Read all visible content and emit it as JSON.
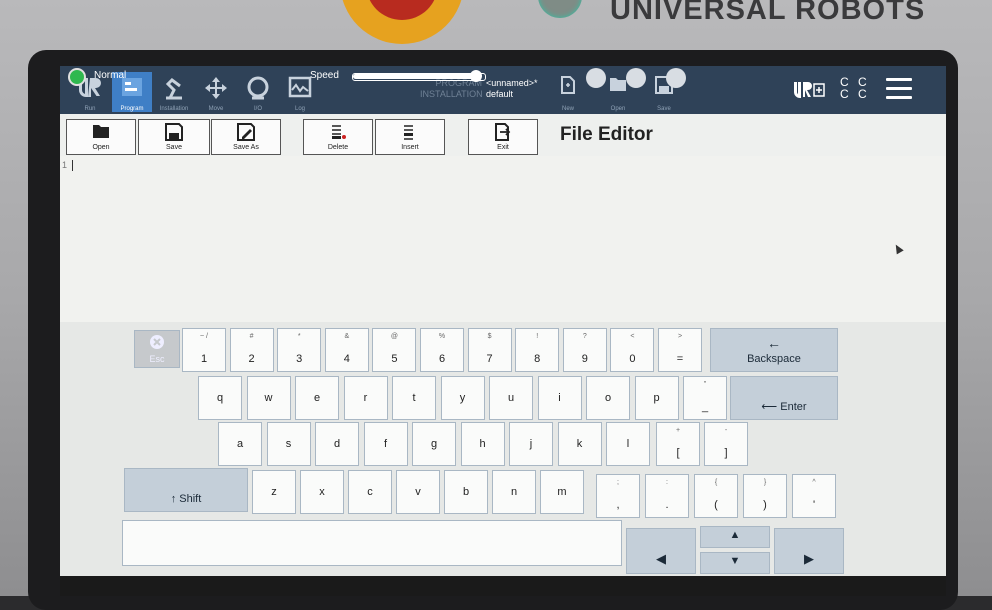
{
  "hardware": {
    "brand": "UNIVERSAL ROBOTS"
  },
  "nav": {
    "items": [
      {
        "label": "Run",
        "icon": "ur-logo-icon"
      },
      {
        "label": "Program",
        "icon": "program-icon",
        "active": true
      },
      {
        "label": "Installation",
        "icon": "installation-icon"
      },
      {
        "label": "Move",
        "icon": "move-icon"
      },
      {
        "label": "I/O",
        "icon": "io-icon"
      },
      {
        "label": "Log",
        "icon": "log-icon"
      }
    ]
  },
  "program_info": {
    "program_key": "PROGRAM",
    "program_value": "<unnamed>*",
    "installation_key": "INSTALLATION",
    "installation_value": "default"
  },
  "file_actions": {
    "new": "New",
    "open": "Open",
    "save": "Save"
  },
  "header_right": {
    "cc": "C C C C"
  },
  "editor": {
    "title": "File Editor",
    "line_number": "1",
    "toolbar": {
      "open": "Open",
      "save": "Save",
      "save_as": "Save As",
      "delete": "Delete",
      "insert": "Insert",
      "exit": "Exit"
    }
  },
  "keyboard": {
    "esc": "Esc",
    "row1": [
      {
        "sub": "~ /",
        "main": "1"
      },
      {
        "sub": "#",
        "main": "2"
      },
      {
        "sub": "*",
        "main": "3"
      },
      {
        "sub": "&",
        "main": "4"
      },
      {
        "sub": "@",
        "main": "5"
      },
      {
        "sub": "%",
        "main": "6"
      },
      {
        "sub": "$",
        "main": "7"
      },
      {
        "sub": "!",
        "main": "8"
      },
      {
        "sub": "?",
        "main": "9"
      },
      {
        "sub": "<",
        "main": "0"
      },
      {
        "sub": ">",
        "main": "="
      }
    ],
    "backspace": "Backspace",
    "row2": [
      "q",
      "w",
      "e",
      "r",
      "t",
      "y",
      "u",
      "i",
      "o",
      "p"
    ],
    "row2_extra": {
      "sub": "\"",
      "main": "_"
    },
    "enter": "Enter",
    "row3": [
      "a",
      "s",
      "d",
      "f",
      "g",
      "h",
      "j",
      "k",
      "l"
    ],
    "row3_extra": [
      {
        "sub": "+",
        "main": "["
      },
      {
        "sub": "-",
        "main": "]"
      }
    ],
    "shift": "Shift",
    "row4": [
      "z",
      "x",
      "c",
      "v",
      "b",
      "n",
      "m"
    ],
    "row4_extra": [
      {
        "sub": ";",
        "main": ","
      },
      {
        "sub": ":",
        "main": "."
      },
      {
        "sub": "{",
        "main": "("
      },
      {
        "sub": "}",
        "main": ")"
      },
      {
        "sub": "^",
        "main": "'"
      }
    ]
  },
  "status": {
    "mode": "Normal",
    "speed_label": "Speed",
    "speed_value": 0.94
  }
}
